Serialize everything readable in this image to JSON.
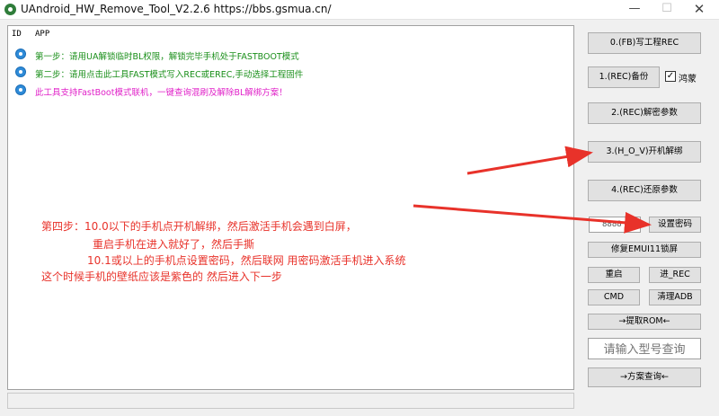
{
  "window": {
    "title": "UAndroid_HW_Remove_Tool_V2.2.6    https://bbs.gsmua.cn/",
    "minimize": "—",
    "maximize": "☐",
    "close": "✕"
  },
  "log": {
    "headers": {
      "id": "ID",
      "app": "APP"
    },
    "rows": [
      {
        "text": "第一步：请用UA解锁临时BL权限，解锁完毕手机处于FASTBOOT模式",
        "color": "#1a8f1a"
      },
      {
        "text": "第二步：请用点击此工具FAST模式写入REC或EREC,手动选择工程固件",
        "color": "#1a8f1a"
      },
      {
        "text": "此工具支持FastBoot模式联机，一键查询混刷及解除BL解绑方案！",
        "color": "#e020c8"
      }
    ]
  },
  "annotation": {
    "line1": "第四步：10.0以下的手机点开机解绑，然后激活手机会遇到白屏，",
    "line2": "重启手机在进入就好了，然后手撕",
    "line3": "10.1或以上的手机点设置密码，然后联网 用密码激活手机进入系统",
    "line4": "这个时候手机的壁纸应该是紫色的 然后进入下一步",
    "color": "#e8322a"
  },
  "buttons": {
    "fb_write": "0.(FB)写工程REC",
    "rec_backup": "1.(REC)备份",
    "hongmeng_label": "鸿蒙",
    "hongmeng_checked": "✓",
    "rec_decrypt": "2.(REC)解密参数",
    "hov_unbind": "3.(H_O_V)开机解绑",
    "rec_restore": "4.(REC)还原参数",
    "password_value": "8888",
    "set_password": "设置密码",
    "fix_emui": "修复EMUI11锁屏",
    "reboot": "重启",
    "enter_rec": "进_REC",
    "cmd": "CMD",
    "clear_adb": "清理ADB",
    "extract_rom": "→提取ROM←",
    "query_placeholder": "请输入型号查询",
    "plan_query": "→方案查询←"
  }
}
